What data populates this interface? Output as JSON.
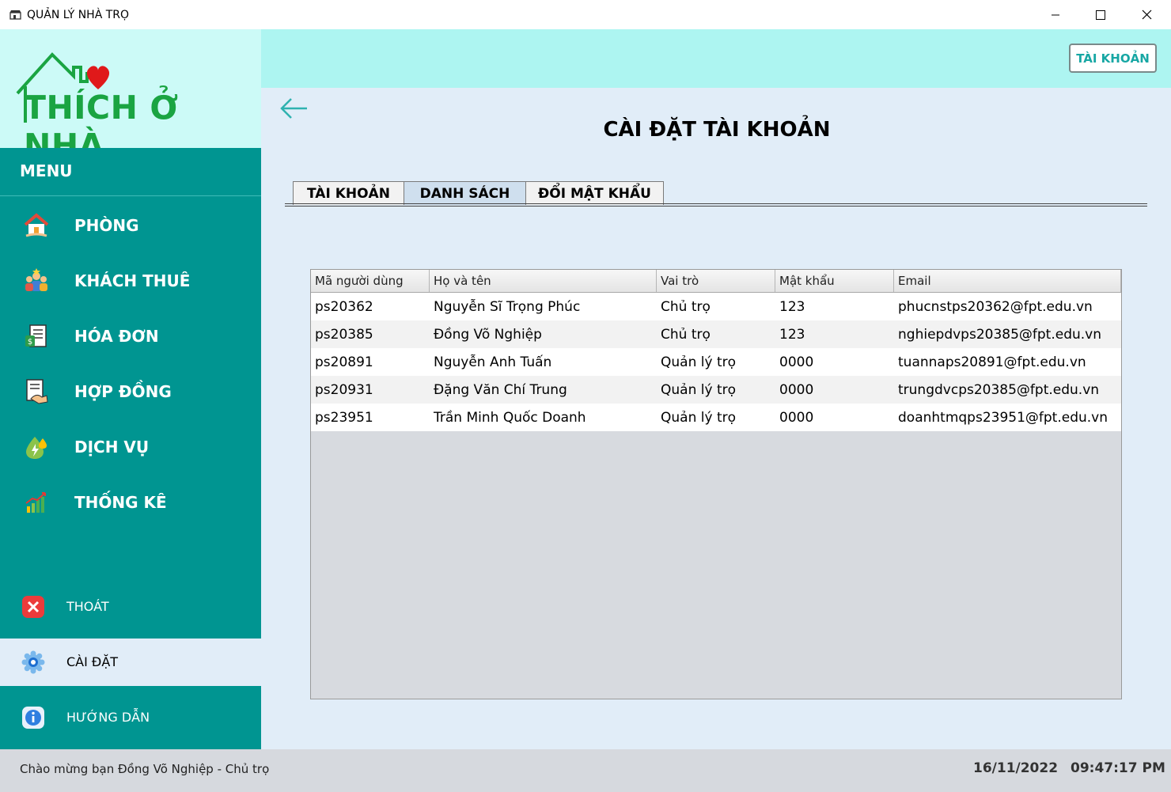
{
  "window": {
    "title": "QUẢN LÝ NHÀ TRỌ"
  },
  "logo": {
    "text": "THÍCH Ở NHÀ"
  },
  "sidebar": {
    "menu_label": "MENU",
    "items": [
      {
        "label": "PHÒNG",
        "icon": "house-icon"
      },
      {
        "label": "KHÁCH THUÊ",
        "icon": "people-icon"
      },
      {
        "label": "HÓA ĐƠN",
        "icon": "invoice-icon"
      },
      {
        "label": "HỢP ĐỒNG",
        "icon": "contract-icon"
      },
      {
        "label": "DỊCH VỤ",
        "icon": "utility-drop-icon"
      },
      {
        "label": "THỐNG KÊ",
        "icon": "chart-icon"
      }
    ],
    "bottom": {
      "exit": "THOÁT",
      "settings": "CÀI ĐẶT",
      "help": "HƯỚNG DẪN"
    }
  },
  "header": {
    "account_button": "TÀI KHOẢN"
  },
  "main": {
    "title": "CÀI ĐẶT TÀI KHOẢN",
    "tabs": [
      {
        "label": "TÀI KHOẢN"
      },
      {
        "label": "DANH SÁCH"
      },
      {
        "label": "ĐỔI MẬT KHẨU"
      }
    ],
    "active_tab": 1
  },
  "table": {
    "columns": [
      "Mã người dùng",
      "Họ và tên",
      "Vai trò",
      "Mật khẩu",
      "Email"
    ],
    "rows": [
      [
        "ps20362",
        "Nguyễn Sĩ Trọng Phúc",
        "Chủ trọ",
        "123",
        "phucnstps20362@fpt.edu.vn"
      ],
      [
        "ps20385",
        "Đồng Võ Nghiệp",
        "Chủ trọ",
        "123",
        "nghiepdvps20385@fpt.edu.vn"
      ],
      [
        "ps20891",
        "Nguyễn Anh Tuấn",
        "Quản lý trọ",
        "0000",
        "tuannaps20891@fpt.edu.vn"
      ],
      [
        "ps20931",
        "Đặng Văn Chí Trung",
        "Quản lý trọ",
        "0000",
        "trungdvcps20385@fpt.edu.vn"
      ],
      [
        "ps23951",
        "Trần Minh Quốc Doanh",
        "Quản lý trọ",
        "0000",
        "doanhtmqps23951@fpt.edu.vn"
      ]
    ]
  },
  "status": {
    "welcome": "Chào mừng bạn Đồng Võ Nghiệp - Chủ trọ",
    "date": "16/11/2022",
    "time": "09:47:17 PM"
  },
  "colors": {
    "sidebar": "#009591",
    "logo_bg": "#ccfaf7",
    "topbar": "#adf5f1",
    "main_bg": "#e1edf8",
    "brand_green": "#1aa442",
    "accent_teal": "#17a7a4"
  }
}
